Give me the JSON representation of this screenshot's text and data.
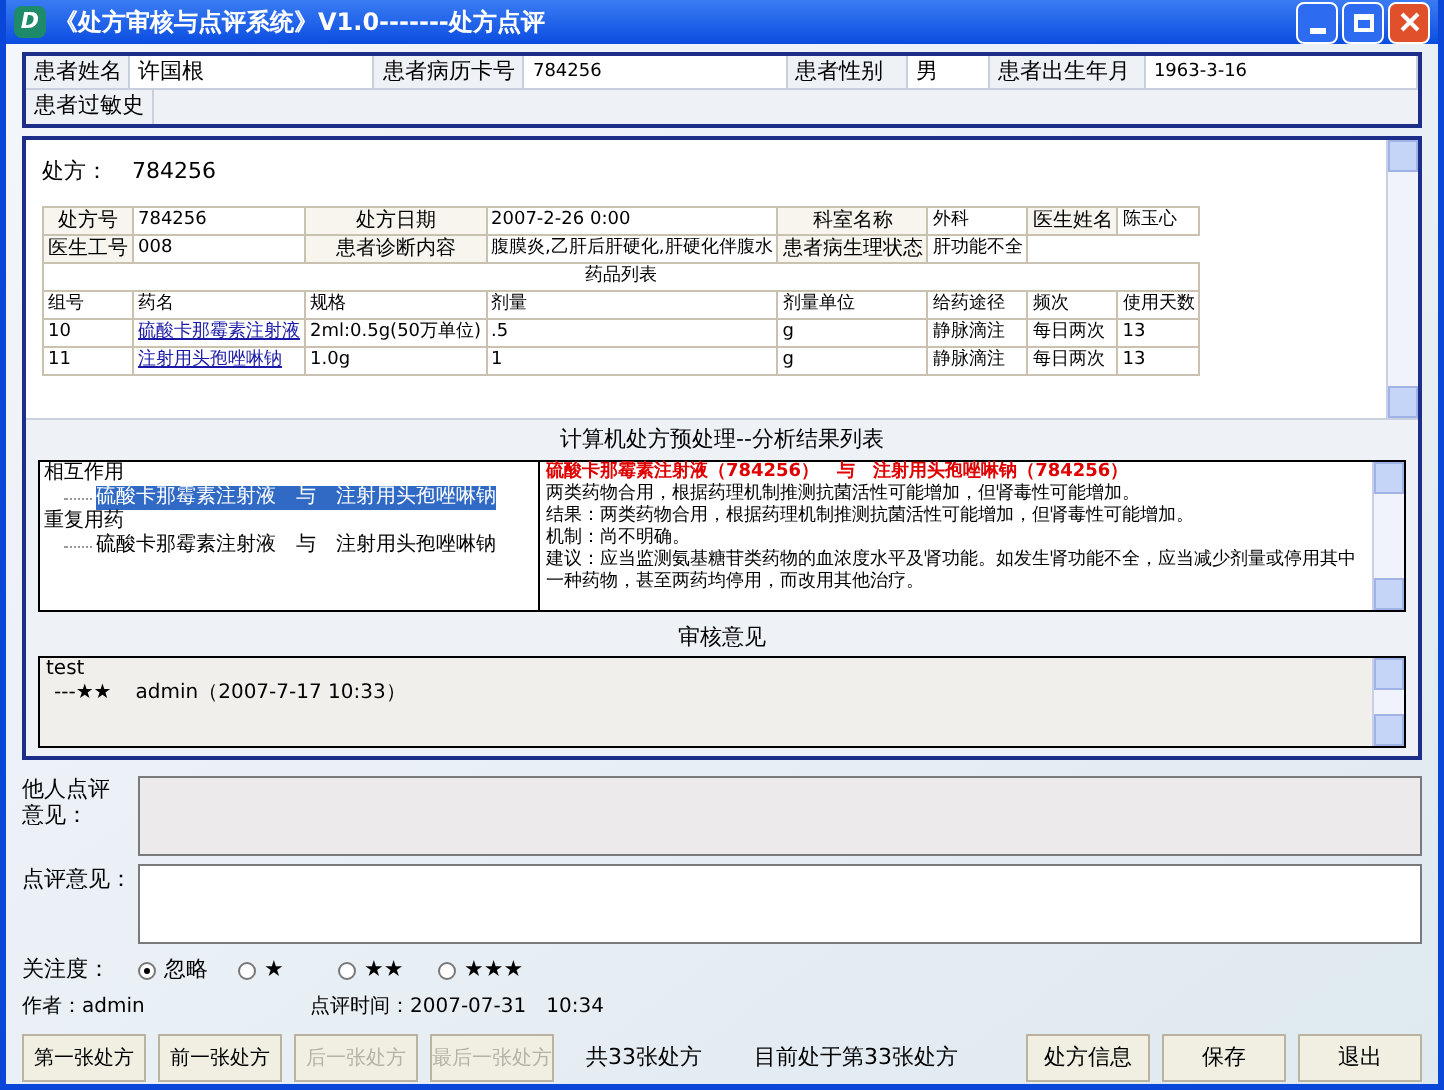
{
  "window": {
    "logo": "D",
    "title": "《处方审核与点评系统》V1.0-------处方点评"
  },
  "patient": {
    "fields": [
      {
        "label": "患者姓名",
        "value": "许国根"
      },
      {
        "label": "患者病历卡号",
        "value": "784256"
      },
      {
        "label": "患者性别",
        "value": "男"
      },
      {
        "label": "患者出生年月",
        "value": "1963-3-16"
      }
    ],
    "allergy_label": "患者过敏史"
  },
  "prescription": {
    "label": "处方：",
    "number": "784256",
    "info_rows": [
      [
        "处方号",
        "784256",
        "处方日期",
        "2007-2-26 0:00",
        "科室名称",
        "外科",
        "医生姓名",
        "陈玉心"
      ],
      [
        "医生工号",
        "008",
        "患者诊断内容",
        "腹膜炎,乙肝后肝硬化,肝硬化伴腹水",
        "患者病生理状态",
        "肝功能不全"
      ]
    ],
    "drug_list_title": "药品列表",
    "columns": [
      "组号",
      "药名",
      "规格",
      "剂量",
      "剂量单位",
      "给药途径",
      "频次",
      "使用天数"
    ],
    "rows": [
      [
        "10",
        "硫酸卡那霉素注射液",
        "2ml:0.5g(50万单位)",
        ".5",
        "g",
        "静脉滴注",
        "每日两次",
        "13"
      ],
      [
        "11",
        "注射用头孢唑啉钠",
        "1.0g",
        "1",
        "g",
        "静脉滴注",
        "每日两次",
        "13"
      ]
    ]
  },
  "analysis": {
    "title": "计算机处方预处理--分析结果列表",
    "tree": [
      {
        "label": "相互作用",
        "children": [
          {
            "label": "硫酸卡那霉素注射液　与　注射用头孢唑啉钠",
            "selected": true
          }
        ]
      },
      {
        "label": "重复用药",
        "children": [
          {
            "label": "硫酸卡那霉素注射液　与　注射用头孢唑啉钠",
            "selected": false
          }
        ]
      }
    ],
    "detail_heading": "硫酸卡那霉素注射液（784256）　与　注射用头孢唑啉钠（784256）",
    "detail_lines": [
      "两类药物合用，根据药理机制推测抗菌活性可能增加，但肾毒性可能增加。",
      "结果：两类药物合用，根据药理机制推测抗菌活性可能增加，但肾毒性可能增加。",
      "机制：尚不明确。",
      "建议：应当监测氨基糖苷类药物的血浓度水平及肾功能。如发生肾功能不全，应当减少剂量或停用其中一种药物，甚至两药均停用，而改用其他治疗。"
    ]
  },
  "review": {
    "title": "审核意见",
    "entries": [
      {
        "text": "test",
        "prefix": "---★★",
        "author": "admin（2007-7-17 10:33）"
      }
    ]
  },
  "others_comment": {
    "label": "他人点评意见："
  },
  "comment": {
    "label": "点评意见："
  },
  "attention": {
    "label": "关注度：",
    "options": [
      {
        "label": "忽略",
        "selected": true
      },
      {
        "label": "★",
        "selected": false
      },
      {
        "label": "★★",
        "selected": false
      },
      {
        "label": "★★★",
        "selected": false
      }
    ]
  },
  "author": {
    "label": "作者：",
    "value": "admin"
  },
  "comment_time": {
    "label": "点评时间：",
    "value": "2007-07-31　10:34"
  },
  "nav_buttons": [
    {
      "label": "第一张处方",
      "disabled": false
    },
    {
      "label": "前一张处方",
      "disabled": false
    },
    {
      "label": "后一张处方",
      "disabled": true
    },
    {
      "label": "最后一张处方",
      "disabled": true
    }
  ],
  "total": "共33张处方",
  "current": "目前处于第33张处方",
  "action_buttons": [
    {
      "label": "处方信息"
    },
    {
      "label": "保存"
    },
    {
      "label": "退出"
    }
  ]
}
